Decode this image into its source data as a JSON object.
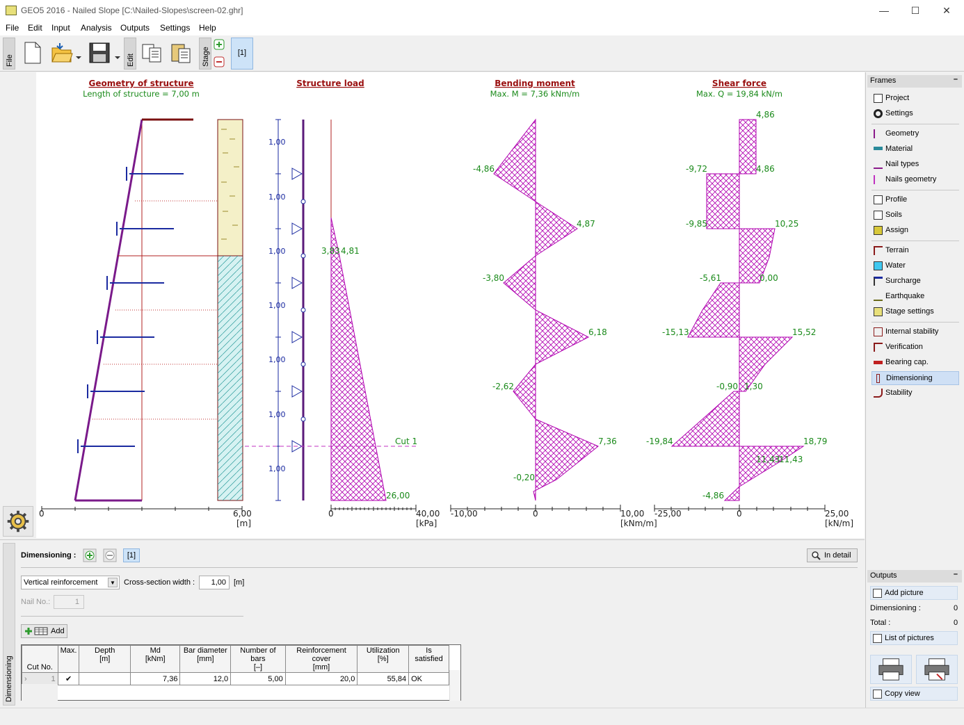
{
  "window": {
    "title": "GEO5 2016 - Nailed Slope [C:\\Nailed-Slopes\\screen-02.ghr]",
    "min": "—",
    "max": "☐",
    "close": "✕"
  },
  "menu": [
    "File",
    "Edit",
    "Input",
    "Analysis",
    "Outputs",
    "Settings",
    "Help"
  ],
  "toolbar": {
    "file_tab": "File",
    "edit_tab": "Edit",
    "stage_tab": "Stage",
    "stage_value": "[1]"
  },
  "drawing": {
    "geometry": {
      "title": "Geometry of structure",
      "subtitle": "Length of structure = 7,00 m",
      "axis_end": "6,00",
      "axis_start": "0",
      "unit": "[m]"
    },
    "load": {
      "title": "Structure load",
      "spacing": [
        "1,00",
        "1,00",
        "1,00",
        "1,00",
        "1,00",
        "1,00",
        "1,00"
      ],
      "label_a": "3,83",
      "label_b": "4,81",
      "label_bottom": "26,00",
      "cut_label": "Cut 1",
      "axis_start": "0",
      "axis_end": "40,00",
      "unit": "[kPa]"
    },
    "moment": {
      "title": "Bending moment",
      "subtitle": "Max. M = 7,36 kNm/m",
      "labels": [
        "-4,86",
        "4,87",
        "-3,80",
        "6,18",
        "-2,62",
        "7,36",
        "-0,20"
      ],
      "axis_start": "-10,00",
      "axis_mid": "0",
      "axis_end": "10,00",
      "unit": "[kNm/m]"
    },
    "shear": {
      "title": "Shear force",
      "subtitle": "Max. Q = 19,84 kN/m",
      "labels_right": [
        "4,86",
        "4,86",
        "10,25",
        "0,00",
        "15,52",
        "1,30",
        "18,79",
        "11,43"
      ],
      "labels_left": [
        "-9,72",
        "-9,85",
        "-5,61",
        "-15,13",
        "-0,90",
        "-19,84",
        "-4,86"
      ],
      "label_mid": "11,43",
      "axis_start": "-25,00",
      "axis_mid": "0",
      "axis_end": "25,00",
      "unit": "[kN/m]"
    }
  },
  "frames": {
    "header": "Frames",
    "collapse": "–",
    "items": [
      "Project",
      "Settings",
      "Geometry",
      "Material",
      "Nail types",
      "Nails geometry",
      "Profile",
      "Soils",
      "Assign",
      "Terrain",
      "Water",
      "Surcharge",
      "Earthquake",
      "Stage settings",
      "Internal stability",
      "Verification",
      "Bearing cap.",
      "Dimensioning",
      "Stability"
    ],
    "selected": "Dimensioning"
  },
  "outputs": {
    "header": "Outputs",
    "collapse": "–",
    "add_picture": "Add picture",
    "dimensioning_label": "Dimensioning :",
    "dimensioning_count": "0",
    "total_label": "Total :",
    "total_count": "0",
    "list_pictures": "List of pictures",
    "copy_view": "Copy view"
  },
  "bottom": {
    "side_label": "Dimensioning",
    "header": "Dimensioning :",
    "stage_btn": "[1]",
    "in_detail": "In detail",
    "reinforcement_type": "Vertical reinforcement",
    "cross_label": "Cross-section width :",
    "cross_value": "1,00",
    "cross_unit": "[m]",
    "nail_label": "Nail No.:",
    "nail_value": "1",
    "add": "Add",
    "columns": [
      [
        "Cut No.",
        ""
      ],
      [
        "Max.",
        ""
      ],
      [
        "Depth",
        "[m]"
      ],
      [
        "Md",
        "[kNm]"
      ],
      [
        "Bar diameter",
        "[mm]"
      ],
      [
        "Number of bars",
        "[–]"
      ],
      [
        "Reinforcement cover",
        "[mm]"
      ],
      [
        "Utilization",
        "[%]"
      ],
      [
        "Is satisfied",
        ""
      ]
    ],
    "row": {
      "cut": "1",
      "max": "✔",
      "depth": "",
      "md": "7,36",
      "diameter": "12,0",
      "bars": "5,00",
      "cover": "20,0",
      "util": "55,84",
      "ok": "OK"
    }
  }
}
